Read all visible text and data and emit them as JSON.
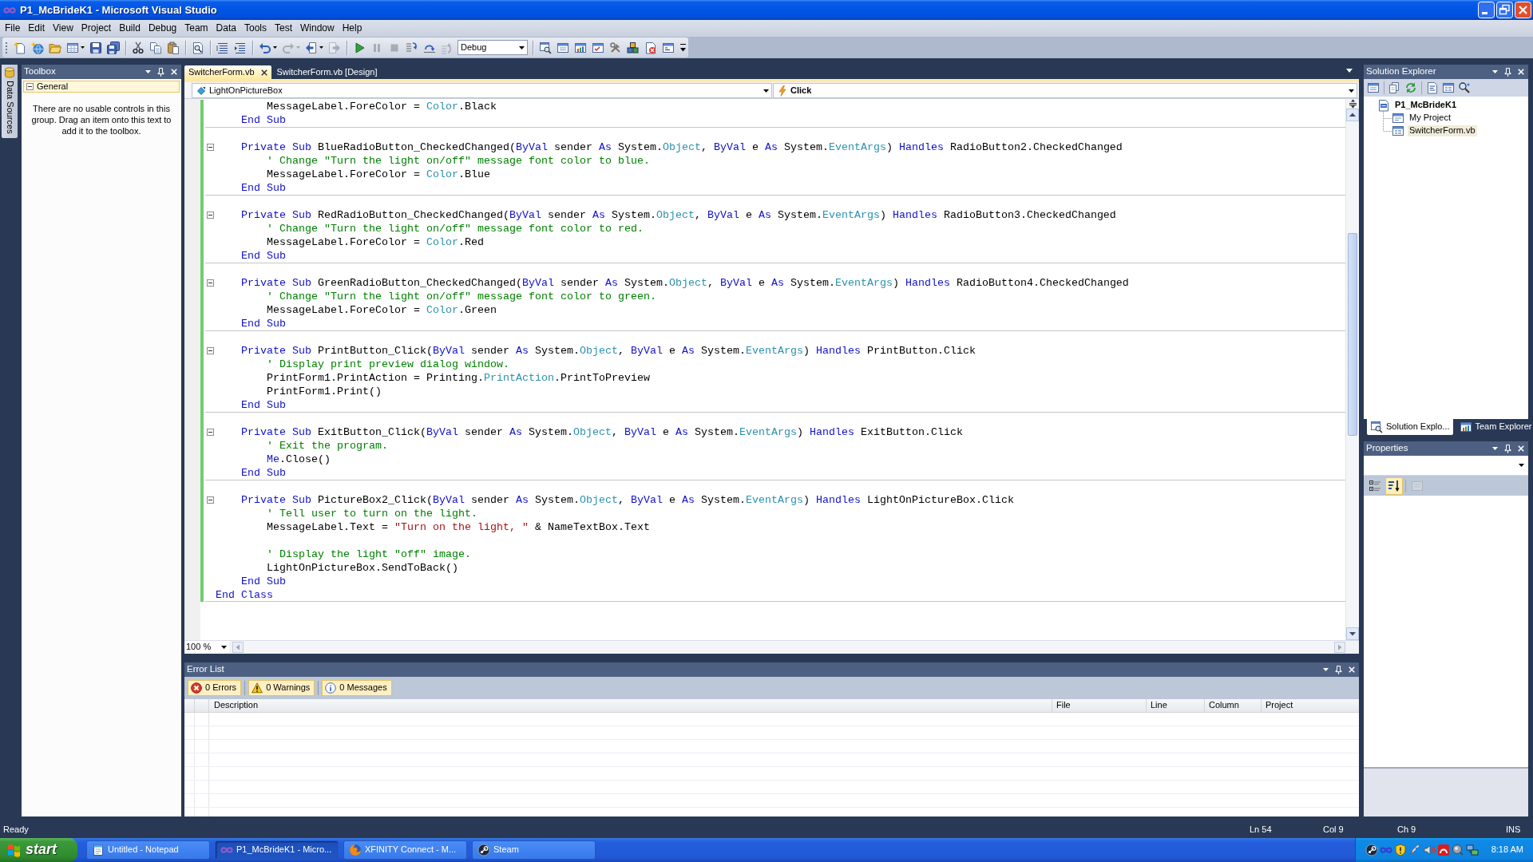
{
  "window": {
    "title": "P1_McBrideK1 - Microsoft Visual Studio"
  },
  "menu": [
    "File",
    "Edit",
    "View",
    "Project",
    "Build",
    "Debug",
    "Team",
    "Data",
    "Tools",
    "Test",
    "Window",
    "Help"
  ],
  "toolbar": {
    "items": [
      {
        "kind": "button",
        "disabled": false
      },
      {
        "kind": "button",
        "disabled": false
      },
      {
        "kind": "button",
        "disabled": false
      },
      {
        "kind": "split",
        "disabled": false
      },
      {
        "kind": "button",
        "disabled": false
      },
      {
        "kind": "button",
        "disabled": false
      },
      {
        "kind": "separator"
      },
      {
        "kind": "button",
        "disabled": false
      },
      {
        "kind": "button",
        "disabled": false
      },
      {
        "kind": "button",
        "disabled": false
      },
      {
        "kind": "separator"
      },
      {
        "kind": "button",
        "disabled": false
      },
      {
        "kind": "separator"
      },
      {
        "kind": "button",
        "disabled": false
      },
      {
        "kind": "button",
        "disabled": false
      },
      {
        "kind": "separator"
      },
      {
        "kind": "split",
        "disabled": false
      },
      {
        "kind": "split",
        "disabled": true
      },
      {
        "kind": "split",
        "disabled": false
      },
      {
        "kind": "button",
        "disabled": true
      },
      {
        "kind": "separator"
      },
      {
        "kind": "button",
        "disabled": false
      },
      {
        "kind": "button",
        "disabled": true
      },
      {
        "kind": "button",
        "disabled": true
      },
      {
        "kind": "button",
        "disabled": false
      },
      {
        "kind": "button",
        "disabled": false
      },
      {
        "kind": "button",
        "disabled": true
      },
      {
        "kind": "combo",
        "value": "Debug"
      },
      {
        "kind": "separator"
      },
      {
        "kind": "button",
        "disabled": false
      },
      {
        "kind": "button",
        "disabled": false
      },
      {
        "kind": "button",
        "disabled": false
      },
      {
        "kind": "button",
        "disabled": false
      },
      {
        "kind": "button",
        "disabled": false
      },
      {
        "kind": "button",
        "disabled": false
      },
      {
        "kind": "button",
        "disabled": false
      },
      {
        "kind": "button",
        "disabled": false
      },
      {
        "kind": "overflow"
      }
    ]
  },
  "side_tabs": [
    {
      "label": "Data Sources"
    }
  ],
  "toolbox": {
    "title": "Toolbox",
    "groups": [
      {
        "label": "General",
        "expanded": true,
        "message": "There are no usable controls in this group. Drag an item onto this text to add it to the toolbox."
      }
    ]
  },
  "editor": {
    "tabs": [
      {
        "label": "SwitcherForm.vb",
        "selected": true
      },
      {
        "label": "SwitcherForm.vb [Design]",
        "selected": false
      }
    ],
    "type_list": "LightOnPictureBox",
    "member_list": "Click",
    "code": {
      "top_lines": [
        {
          "kind": "code",
          "tokens": [
            {
              "kind": "plain",
              "text": "        MessageLabel.ForeColor = "
            },
            {
              "kind": "type",
              "text": "Color"
            },
            {
              "kind": "plain",
              "text": ".Black"
            }
          ]
        },
        {
          "kind": "code",
          "tokens": [
            {
              "kind": "keyword",
              "text": "    End Sub"
            }
          ]
        }
      ],
      "members": [
        {
          "expanded": true,
          "lines": [
            {
              "kind": "blank"
            },
            {
              "kind": "declaration",
              "tokens": [
                {
                  "kind": "keyword",
                  "text": "    Private Sub"
                },
                {
                  "kind": "plain",
                  "text": " BlueRadioButton_CheckedChanged("
                },
                {
                  "kind": "keyword",
                  "text": "ByVal"
                },
                {
                  "kind": "plain",
                  "text": " sender "
                },
                {
                  "kind": "keyword",
                  "text": "As"
                },
                {
                  "kind": "plain",
                  "text": " System."
                },
                {
                  "kind": "type",
                  "text": "Object"
                },
                {
                  "kind": "plain",
                  "text": ", "
                },
                {
                  "kind": "keyword",
                  "text": "ByVal"
                },
                {
                  "kind": "plain",
                  "text": " e "
                },
                {
                  "kind": "keyword",
                  "text": "As"
                },
                {
                  "kind": "plain",
                  "text": " System."
                },
                {
                  "kind": "type",
                  "text": "EventArgs"
                },
                {
                  "kind": "plain",
                  "text": ") "
                },
                {
                  "kind": "keyword",
                  "text": "Handles"
                },
                {
                  "kind": "plain",
                  "text": " RadioButton2.CheckedChanged"
                }
              ]
            },
            {
              "kind": "code",
              "tokens": [
                {
                  "kind": "comment",
                  "text": "        ' Change \"Turn the light on/off\" message font color to blue."
                }
              ]
            },
            {
              "kind": "code",
              "tokens": [
                {
                  "kind": "plain",
                  "text": "        MessageLabel.ForeColor = "
                },
                {
                  "kind": "type",
                  "text": "Color"
                },
                {
                  "kind": "plain",
                  "text": ".Blue"
                }
              ]
            },
            {
              "kind": "code",
              "tokens": [
                {
                  "kind": "keyword",
                  "text": "    End Sub"
                }
              ]
            }
          ]
        },
        {
          "expanded": true,
          "lines": [
            {
              "kind": "blank"
            },
            {
              "kind": "declaration",
              "tokens": [
                {
                  "kind": "keyword",
                  "text": "    Private Sub"
                },
                {
                  "kind": "plain",
                  "text": " RedRadioButton_CheckedChanged("
                },
                {
                  "kind": "keyword",
                  "text": "ByVal"
                },
                {
                  "kind": "plain",
                  "text": " sender "
                },
                {
                  "kind": "keyword",
                  "text": "As"
                },
                {
                  "kind": "plain",
                  "text": " System."
                },
                {
                  "kind": "type",
                  "text": "Object"
                },
                {
                  "kind": "plain",
                  "text": ", "
                },
                {
                  "kind": "keyword",
                  "text": "ByVal"
                },
                {
                  "kind": "plain",
                  "text": " e "
                },
                {
                  "kind": "keyword",
                  "text": "As"
                },
                {
                  "kind": "plain",
                  "text": " System."
                },
                {
                  "kind": "type",
                  "text": "EventArgs"
                },
                {
                  "kind": "plain",
                  "text": ") "
                },
                {
                  "kind": "keyword",
                  "text": "Handles"
                },
                {
                  "kind": "plain",
                  "text": " RadioButton3.CheckedChanged"
                }
              ]
            },
            {
              "kind": "code",
              "tokens": [
                {
                  "kind": "comment",
                  "text": "        ' Change \"Turn the light on/off\" message font color to red."
                }
              ]
            },
            {
              "kind": "code",
              "tokens": [
                {
                  "kind": "plain",
                  "text": "        MessageLabel.ForeColor = "
                },
                {
                  "kind": "type",
                  "text": "Color"
                },
                {
                  "kind": "plain",
                  "text": ".Red"
                }
              ]
            },
            {
              "kind": "code",
              "tokens": [
                {
                  "kind": "keyword",
                  "text": "    End Sub"
                }
              ]
            }
          ]
        },
        {
          "expanded": true,
          "lines": [
            {
              "kind": "blank"
            },
            {
              "kind": "declaration",
              "tokens": [
                {
                  "kind": "keyword",
                  "text": "    Private Sub"
                },
                {
                  "kind": "plain",
                  "text": " GreenRadioButton_CheckedChanged("
                },
                {
                  "kind": "keyword",
                  "text": "ByVal"
                },
                {
                  "kind": "plain",
                  "text": " sender "
                },
                {
                  "kind": "keyword",
                  "text": "As"
                },
                {
                  "kind": "plain",
                  "text": " System."
                },
                {
                  "kind": "type",
                  "text": "Object"
                },
                {
                  "kind": "plain",
                  "text": ", "
                },
                {
                  "kind": "keyword",
                  "text": "ByVal"
                },
                {
                  "kind": "plain",
                  "text": " e "
                },
                {
                  "kind": "keyword",
                  "text": "As"
                },
                {
                  "kind": "plain",
                  "text": " System."
                },
                {
                  "kind": "type",
                  "text": "EventArgs"
                },
                {
                  "kind": "plain",
                  "text": ") "
                },
                {
                  "kind": "keyword",
                  "text": "Handles"
                },
                {
                  "kind": "plain",
                  "text": " RadioButton4.CheckedChanged"
                }
              ]
            },
            {
              "kind": "code",
              "tokens": [
                {
                  "kind": "comment",
                  "text": "        ' Change \"Turn the light on/off\" message font color to green."
                }
              ]
            },
            {
              "kind": "code",
              "tokens": [
                {
                  "kind": "plain",
                  "text": "        MessageLabel.ForeColor = "
                },
                {
                  "kind": "type",
                  "text": "Color"
                },
                {
                  "kind": "plain",
                  "text": ".Green"
                }
              ]
            },
            {
              "kind": "code",
              "tokens": [
                {
                  "kind": "keyword",
                  "text": "    End Sub"
                }
              ]
            }
          ]
        },
        {
          "expanded": true,
          "lines": [
            {
              "kind": "blank"
            },
            {
              "kind": "declaration",
              "tokens": [
                {
                  "kind": "keyword",
                  "text": "    Private Sub"
                },
                {
                  "kind": "plain",
                  "text": " PrintButton_Click("
                },
                {
                  "kind": "keyword",
                  "text": "ByVal"
                },
                {
                  "kind": "plain",
                  "text": " sender "
                },
                {
                  "kind": "keyword",
                  "text": "As"
                },
                {
                  "kind": "plain",
                  "text": " System."
                },
                {
                  "kind": "type",
                  "text": "Object"
                },
                {
                  "kind": "plain",
                  "text": ", "
                },
                {
                  "kind": "keyword",
                  "text": "ByVal"
                },
                {
                  "kind": "plain",
                  "text": " e "
                },
                {
                  "kind": "keyword",
                  "text": "As"
                },
                {
                  "kind": "plain",
                  "text": " System."
                },
                {
                  "kind": "type",
                  "text": "EventArgs"
                },
                {
                  "kind": "plain",
                  "text": ") "
                },
                {
                  "kind": "keyword",
                  "text": "Handles"
                },
                {
                  "kind": "plain",
                  "text": " PrintButton.Click"
                }
              ]
            },
            {
              "kind": "code",
              "tokens": [
                {
                  "kind": "comment",
                  "text": "        ' Display print preview dialog window."
                }
              ]
            },
            {
              "kind": "code",
              "tokens": [
                {
                  "kind": "plain",
                  "text": "        PrintForm1.PrintAction = Printing."
                },
                {
                  "kind": "type",
                  "text": "PrintAction"
                },
                {
                  "kind": "plain",
                  "text": ".PrintToPreview"
                }
              ]
            },
            {
              "kind": "code",
              "tokens": [
                {
                  "kind": "plain",
                  "text": "        PrintForm1.Print()"
                }
              ]
            },
            {
              "kind": "code",
              "tokens": [
                {
                  "kind": "keyword",
                  "text": "    End Sub"
                }
              ]
            }
          ]
        },
        {
          "expanded": true,
          "lines": [
            {
              "kind": "blank"
            },
            {
              "kind": "declaration",
              "tokens": [
                {
                  "kind": "keyword",
                  "text": "    Private Sub"
                },
                {
                  "kind": "plain",
                  "text": " ExitButton_Click("
                },
                {
                  "kind": "keyword",
                  "text": "ByVal"
                },
                {
                  "kind": "plain",
                  "text": " sender "
                },
                {
                  "kind": "keyword",
                  "text": "As"
                },
                {
                  "kind": "plain",
                  "text": " System."
                },
                {
                  "kind": "type",
                  "text": "Object"
                },
                {
                  "kind": "plain",
                  "text": ", "
                },
                {
                  "kind": "keyword",
                  "text": "ByVal"
                },
                {
                  "kind": "plain",
                  "text": " e "
                },
                {
                  "kind": "keyword",
                  "text": "As"
                },
                {
                  "kind": "plain",
                  "text": " System."
                },
                {
                  "kind": "type",
                  "text": "EventArgs"
                },
                {
                  "kind": "plain",
                  "text": ") "
                },
                {
                  "kind": "keyword",
                  "text": "Handles"
                },
                {
                  "kind": "plain",
                  "text": " ExitButton.Click"
                }
              ]
            },
            {
              "kind": "code",
              "tokens": [
                {
                  "kind": "comment",
                  "text": "        ' Exit the program."
                }
              ]
            },
            {
              "kind": "code",
              "tokens": [
                {
                  "kind": "keyword",
                  "text": "        Me"
                },
                {
                  "kind": "plain",
                  "text": ".Close()"
                }
              ]
            },
            {
              "kind": "code",
              "tokens": [
                {
                  "kind": "keyword",
                  "text": "    End Sub"
                }
              ]
            }
          ]
        },
        {
          "expanded": true,
          "lines": [
            {
              "kind": "blank"
            },
            {
              "kind": "declaration",
              "tokens": [
                {
                  "kind": "keyword",
                  "text": "    Private Sub"
                },
                {
                  "kind": "plain",
                  "text": " PictureBox2_Click("
                },
                {
                  "kind": "keyword",
                  "text": "ByVal"
                },
                {
                  "kind": "plain",
                  "text": " sender "
                },
                {
                  "kind": "keyword",
                  "text": "As"
                },
                {
                  "kind": "plain",
                  "text": " System."
                },
                {
                  "kind": "type",
                  "text": "Object"
                },
                {
                  "kind": "plain",
                  "text": ", "
                },
                {
                  "kind": "keyword",
                  "text": "ByVal"
                },
                {
                  "kind": "plain",
                  "text": " e "
                },
                {
                  "kind": "keyword",
                  "text": "As"
                },
                {
                  "kind": "plain",
                  "text": " System."
                },
                {
                  "kind": "type",
                  "text": "EventArgs"
                },
                {
                  "kind": "plain",
                  "text": ") "
                },
                {
                  "kind": "keyword",
                  "text": "Handles"
                },
                {
                  "kind": "plain",
                  "text": " LightOnPictureBox.Click"
                }
              ]
            },
            {
              "kind": "code",
              "tokens": [
                {
                  "kind": "comment",
                  "text": "        ' Tell user to turn on the light."
                }
              ]
            },
            {
              "kind": "code",
              "tokens": [
                {
                  "kind": "plain",
                  "text": "        MessageLabel.Text = "
                },
                {
                  "kind": "string",
                  "text": "\"Turn on the light, \""
                },
                {
                  "kind": "plain",
                  "text": " & NameTextBox.Text"
                }
              ]
            },
            {
              "kind": "blank"
            },
            {
              "kind": "code",
              "tokens": [
                {
                  "kind": "comment",
                  "text": "        ' Display the light \"off\" image."
                }
              ]
            },
            {
              "kind": "code",
              "tokens": [
                {
                  "kind": "plain",
                  "text": "        LightOnPictureBox.SendToBack()"
                }
              ]
            },
            {
              "kind": "code",
              "tokens": [
                {
                  "kind": "keyword",
                  "text": "    End Sub"
                }
              ]
            }
          ]
        }
      ],
      "closing_lines": [
        {
          "kind": "code",
          "tokens": [
            {
              "kind": "keyword",
              "text": "End Class"
            }
          ]
        }
      ]
    },
    "zoom": "100 %"
  },
  "error_list": {
    "title": "Error List",
    "filters": [
      {
        "kind": "error",
        "label": "0 Errors",
        "on": true
      },
      {
        "kind": "warning",
        "label": "0 Warnings",
        "on": true
      },
      {
        "kind": "message",
        "label": "0 Messages",
        "on": true
      }
    ],
    "columns": [
      "Description",
      "File",
      "Line",
      "Column",
      "Project"
    ]
  },
  "solution_explorer": {
    "title": "Solution Explorer",
    "tree": [
      {
        "label": "P1_McBrideK1",
        "kind": "project",
        "selected": false,
        "children": [
          {
            "label": "My Project",
            "kind": "settings",
            "selected": false
          },
          {
            "label": "SwitcherForm.vb",
            "kind": "form",
            "selected": true
          }
        ]
      }
    ],
    "tabs": [
      {
        "label": "Solution Explo...",
        "kind": "solution",
        "selected": true
      },
      {
        "label": "Team Explorer",
        "kind": "team",
        "selected": false
      }
    ]
  },
  "properties": {
    "title": "Properties",
    "buttons": [
      {
        "kind": "categorized",
        "selected": false,
        "disabled": false
      },
      {
        "kind": "alphabetical",
        "selected": true,
        "disabled": false
      },
      {
        "kind": "pages",
        "selected": false,
        "disabled": true
      }
    ]
  },
  "status_bar": {
    "message": "Ready",
    "line": "Ln 54",
    "column": "Col 9",
    "character": "Ch 9",
    "mode": "INS"
  },
  "taskbar": {
    "start": "start",
    "tasks": [
      {
        "label": "Untitled - Notepad",
        "kind": "notepad",
        "selected": false
      },
      {
        "label": "P1_McBrideK1 - Micro...",
        "kind": "ide",
        "selected": true
      },
      {
        "label": "XFINITY Connect - M...",
        "kind": "browser",
        "selected": false
      },
      {
        "label": "Steam",
        "kind": "game",
        "selected": false
      }
    ],
    "clock": "8:18 AM"
  }
}
